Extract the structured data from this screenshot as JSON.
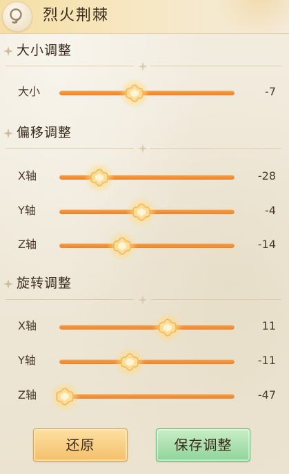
{
  "header": {
    "title": "烈火荆棘",
    "icon": "search-icon"
  },
  "sections": [
    {
      "title": "大小调整",
      "rows": [
        {
          "label": "大小",
          "value": "-7",
          "level": 0.43
        }
      ]
    },
    {
      "title": "偏移调整",
      "rows": [
        {
          "label": "X轴",
          "value": "-28",
          "level": 0.23
        },
        {
          "label": "Y轴",
          "value": "-4",
          "level": 0.47
        },
        {
          "label": "Z轴",
          "value": "-14",
          "level": 0.36
        }
      ]
    },
    {
      "title": "旋转调整",
      "rows": [
        {
          "label": "X轴",
          "value": "11",
          "level": 0.62
        },
        {
          "label": "Y轴",
          "value": "-11",
          "level": 0.4
        },
        {
          "label": "Z轴",
          "value": "-47",
          "level": 0.03
        }
      ]
    }
  ],
  "buttons": {
    "reset_label": "还原",
    "save_label": "保存调整"
  },
  "colors": {
    "track": "#ef8f36",
    "knob": "#ffd88a",
    "reset_button": "#f8cf85",
    "save_button": "#a9e0ae"
  }
}
